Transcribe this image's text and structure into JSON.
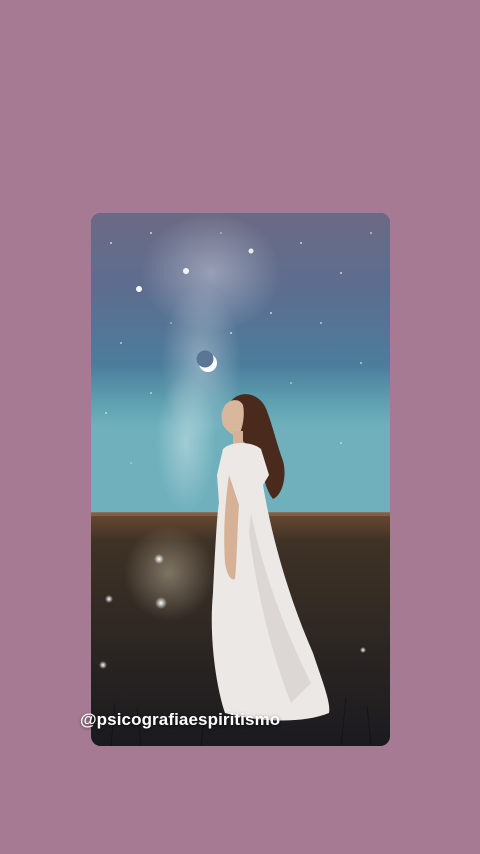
{
  "story": {
    "background_color": "#a67a93",
    "image_description_icon": "photo-woman-under-night-sky",
    "watermark_text": "@psicografiaespiritismo"
  }
}
